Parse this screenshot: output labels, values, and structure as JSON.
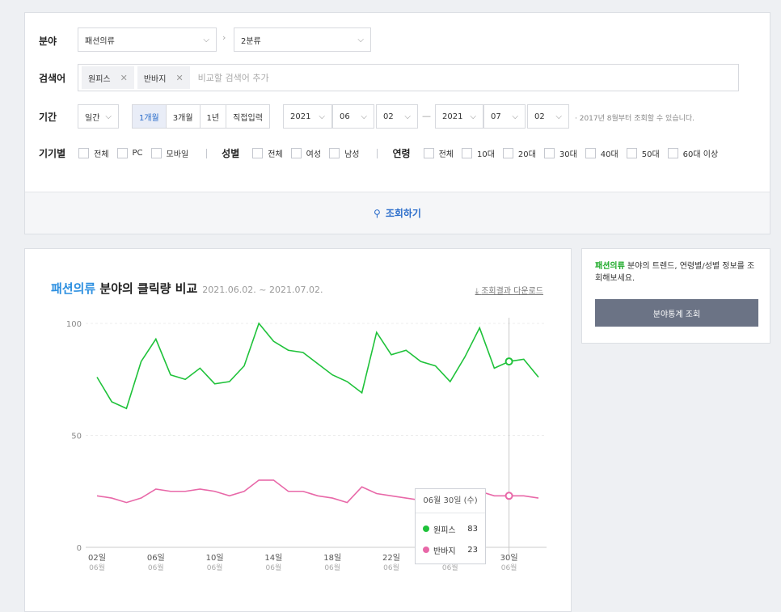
{
  "filters": {
    "category_label": "분야",
    "category1": "패션의류",
    "category2": "2분류",
    "keyword_label": "검색어",
    "keywords": [
      "원피스",
      "반바지"
    ],
    "keyword_placeholder": "비교할 검색어 추가",
    "period_label": "기간",
    "period_unit": "일간",
    "period_options": [
      "1개월",
      "3개월",
      "1년",
      "직접입력"
    ],
    "period_active": "1개월",
    "start_year": "2021",
    "start_month": "06",
    "start_day": "02",
    "end_year": "2021",
    "end_month": "07",
    "end_day": "02",
    "range_hint": "· 2017년 8월부터 조회할 수 있습니다.",
    "device_label": "기기별",
    "device_options": [
      "전체",
      "PC",
      "모바일"
    ],
    "gender_label": "성별",
    "gender_options": [
      "전체",
      "여성",
      "남성"
    ],
    "age_label": "연령",
    "age_options": [
      "전체",
      "10대",
      "20대",
      "30대",
      "40대",
      "50대",
      "60대 이상"
    ],
    "search_button": "조회하기"
  },
  "side": {
    "highlight": "패션의류",
    "text": " 분야의 트렌드, 연령별/성별 정보를 조회해보세요.",
    "button": "분야통계 조회"
  },
  "chart_header": {
    "title_highlight": "패션의류",
    "title_rest": " 분야의 클릭량 비교",
    "date_range": "2021.06.02. ~ 2021.07.02.",
    "download": "조회결과 다운로드"
  },
  "tooltip": {
    "date": "06월 30일 (수)",
    "rows": [
      {
        "name": "원피스",
        "value": "83"
      },
      {
        "name": "반바지",
        "value": "23"
      }
    ]
  },
  "colors": {
    "series1": "#1fc23a",
    "series2": "#e868a8",
    "accent": "#2c6ecb"
  },
  "chart_data": {
    "type": "line",
    "ylim": [
      0,
      100
    ],
    "yticks": [
      0,
      50,
      100
    ],
    "xtick_labels": [
      "02일",
      "06일",
      "10일",
      "14일",
      "18일",
      "22일",
      "26일",
      "30일"
    ],
    "xtick_sublabel": "06월",
    "x": [
      "06-02",
      "06-03",
      "06-04",
      "06-05",
      "06-06",
      "06-07",
      "06-08",
      "06-09",
      "06-10",
      "06-11",
      "06-12",
      "06-13",
      "06-14",
      "06-15",
      "06-16",
      "06-17",
      "06-18",
      "06-19",
      "06-20",
      "06-21",
      "06-22",
      "06-23",
      "06-24",
      "06-25",
      "06-26",
      "06-27",
      "06-28",
      "06-29",
      "06-30",
      "07-01",
      "07-02"
    ],
    "series": [
      {
        "name": "원피스",
        "values": [
          76,
          65,
          62,
          83,
          93,
          77,
          75,
          80,
          73,
          74,
          81,
          100,
          92,
          88,
          87,
          82,
          77,
          74,
          69,
          96,
          86,
          88,
          83,
          81,
          74,
          85,
          98,
          80,
          83,
          84,
          76
        ]
      },
      {
        "name": "반바지",
        "values": [
          23,
          22,
          20,
          22,
          26,
          25,
          25,
          26,
          25,
          23,
          25,
          30,
          30,
          25,
          25,
          23,
          22,
          20,
          27,
          24,
          23,
          22,
          21,
          21,
          23,
          23,
          25,
          23,
          23,
          23,
          22
        ]
      }
    ]
  }
}
